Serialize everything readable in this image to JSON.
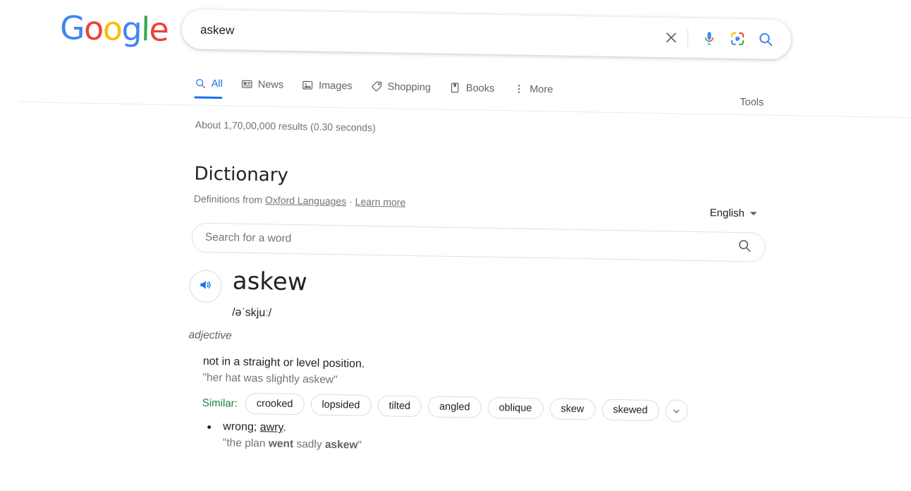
{
  "brand": {
    "name": "Google",
    "letters": [
      {
        "ch": "G",
        "color": "#4285F4"
      },
      {
        "ch": "o",
        "color": "#EA4335"
      },
      {
        "ch": "o",
        "color": "#FBBC05"
      },
      {
        "ch": "g",
        "color": "#4285F4"
      },
      {
        "ch": "l",
        "color": "#34A853"
      },
      {
        "ch": "e",
        "color": "#EA4335"
      }
    ]
  },
  "search": {
    "query": "askew",
    "placeholder": "Search",
    "clear_label": "Clear",
    "voice_label": "Search by voice",
    "lens_label": "Search by image",
    "submit_label": "Google Search"
  },
  "tabs": [
    {
      "label": "All",
      "icon": "search-icon",
      "active": true
    },
    {
      "label": "News",
      "icon": "news-icon",
      "active": false
    },
    {
      "label": "Images",
      "icon": "images-icon",
      "active": false
    },
    {
      "label": "Shopping",
      "icon": "shopping-tag-icon",
      "active": false
    },
    {
      "label": "Books",
      "icon": "book-icon",
      "active": false
    },
    {
      "label": "More",
      "icon": "more-vertical-icon",
      "active": false
    }
  ],
  "tools_label": "Tools",
  "result_stats": "About 1,70,00,000 results (0.30 seconds)",
  "dictionary": {
    "title": "Dictionary",
    "source_prefix": "Definitions from",
    "source_link": "Oxford Languages",
    "source_separator": "·",
    "learn_more": "Learn more",
    "language": "English",
    "word_search_placeholder": "Search for a word",
    "headword": "askew",
    "phonetic": "/əˈskjuː/",
    "part_of_speech": "adjective",
    "definitions": [
      {
        "text": "not in a straight or level position.",
        "example": "\"her hat was slightly askew\"",
        "bulleted": false
      },
      {
        "text_before": "wrong; ",
        "link": "awry",
        "text_after": ".",
        "example_parts": [
          {
            "t": "\"the plan ",
            "bold": false
          },
          {
            "t": "went",
            "bold": true
          },
          {
            "t": " sadly ",
            "bold": false
          },
          {
            "t": "askew",
            "bold": true
          },
          {
            "t": "\"",
            "bold": false
          }
        ],
        "bulleted": true
      }
    ],
    "similar_label": "Similar:",
    "similar": [
      "crooked",
      "lopsided",
      "tilted",
      "angled",
      "oblique",
      "skew",
      "skewed"
    ],
    "expand_label": "Show more synonyms"
  },
  "colors": {
    "accent_blue": "#1a73e8",
    "green": "#188038",
    "text": "#202124",
    "muted": "#70757a"
  }
}
